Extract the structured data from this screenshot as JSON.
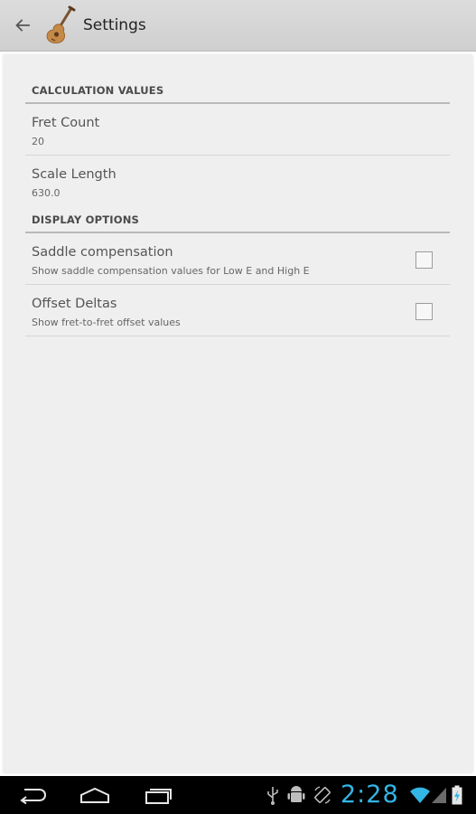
{
  "action_bar": {
    "title": "Settings",
    "back_icon": "arrow-left-icon",
    "app_icon": "guitar-icon"
  },
  "categories": [
    {
      "label": "CALCULATION VALUES",
      "items": [
        {
          "title": "Fret Count",
          "summary": "20",
          "has_checkbox": false
        },
        {
          "title": "Scale Length",
          "summary": "630.0",
          "has_checkbox": false
        }
      ]
    },
    {
      "label": "DISPLAY OPTIONS",
      "items": [
        {
          "title": "Saddle compensation",
          "summary": "Show saddle compensation values for Low E and High E",
          "has_checkbox": true,
          "checked": false
        },
        {
          "title": "Offset Deltas",
          "summary": "Show fret-to-fret offset values",
          "has_checkbox": true,
          "checked": false
        }
      ]
    }
  ],
  "system_bar": {
    "time": "2:28",
    "icons": [
      "usb-icon",
      "android-debug-icon",
      "screen-rotation-icon",
      "wifi-icon",
      "cell-signal-icon",
      "battery-charging-icon"
    ],
    "nav_icons": [
      "back-nav-icon",
      "home-nav-icon",
      "recent-apps-icon"
    ],
    "accent_color": "#33b5e5"
  }
}
